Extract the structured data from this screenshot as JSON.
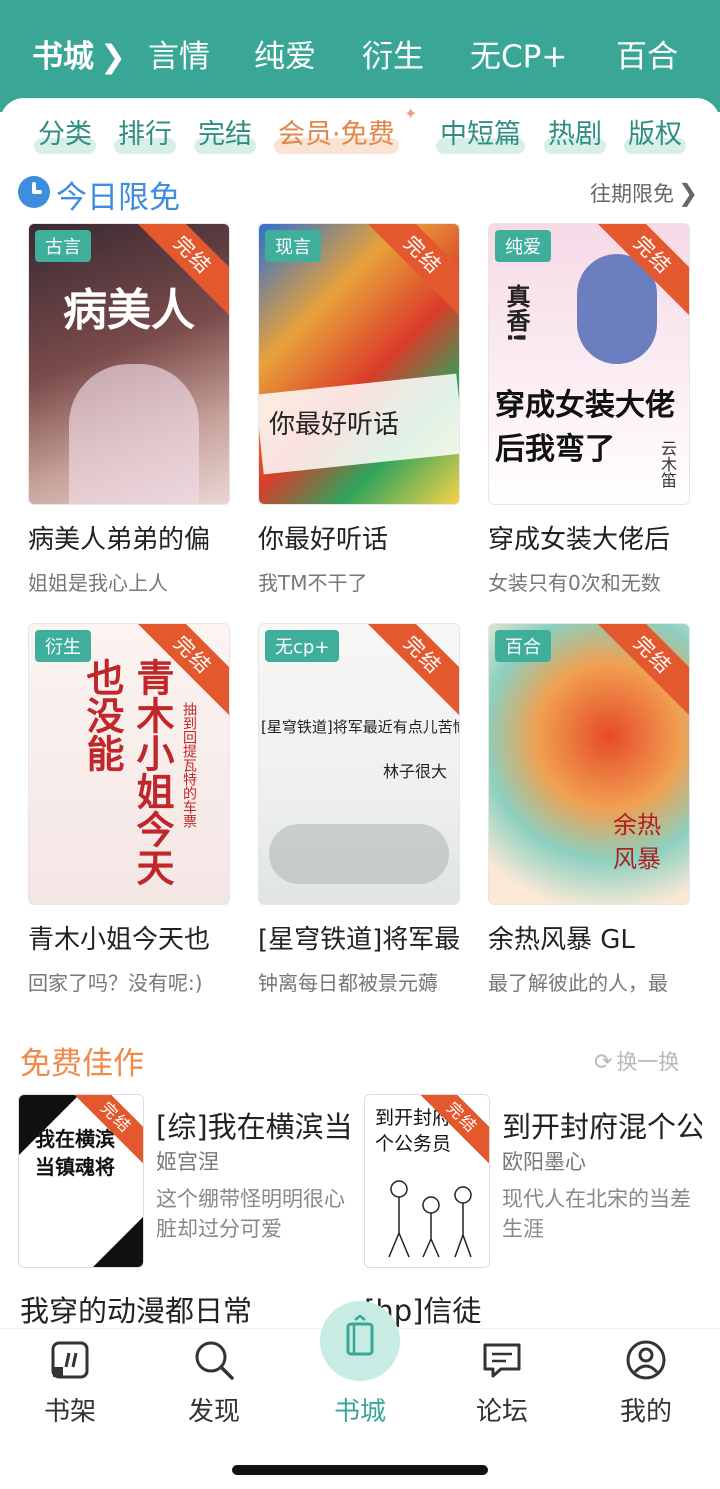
{
  "header": {
    "tabs": [
      {
        "label": "书城",
        "active": true,
        "chevron": "❯"
      },
      {
        "label": "言情"
      },
      {
        "label": "纯爱"
      },
      {
        "label": "衍生"
      },
      {
        "label": "无CP+"
      },
      {
        "label": "百合"
      }
    ],
    "accent_color": "#3aa796"
  },
  "subnav": {
    "items": [
      "分类",
      "排行",
      "完结",
      "会员·免费",
      "中短篇",
      "热剧",
      "版权"
    ]
  },
  "limited_free": {
    "title": "今日限免",
    "more": "往期限免",
    "icon": "clock-icon",
    "books": [
      {
        "genre": "古言",
        "status": "完结",
        "title": "病美人弟弟的偏",
        "desc": "姐姐是我心上人",
        "cover_text": "病美人"
      },
      {
        "genre": "现言",
        "status": "完结",
        "title": "你最好听话",
        "desc": "我TM不干了",
        "cover_text": "你最好听话"
      },
      {
        "genre": "纯爱",
        "status": "完结",
        "title": "穿成女装大佬后",
        "desc": "女装只有0次和无数",
        "cover_text": "穿成女装大佬后我弯了",
        "cover_text2": "真香!",
        "cover_author": "云木笛"
      },
      {
        "genre": "衍生",
        "status": "完结",
        "title": "青木小姐今天也",
        "desc": "回家了吗？没有呢:)",
        "cover_text": "青木小姐今天也没能",
        "cover_sub": "抽到回提瓦特的车票"
      },
      {
        "genre": "无cp+",
        "status": "完结",
        "title": "[星穹铁道]将军最",
        "desc": "钟离每日都被景元薅",
        "cover_text": "[星穹铁道]将军最近有点儿苦恼",
        "cover_author": "林子很大"
      },
      {
        "genre": "百合",
        "status": "完结",
        "title": "余热风暴 GL",
        "desc": "最了解彼此的人，最",
        "cover_text": "余热风暴"
      }
    ]
  },
  "free_works": {
    "title": "免费佳作",
    "refresh": "换一换",
    "books": [
      {
        "status": "完结",
        "title": "[综]我在横滨当",
        "author": "姬宫涅",
        "desc": "这个绷带怪明明很心脏却过分可爱",
        "cover_text": "我在横滨当镇魂将"
      },
      {
        "status": "完结",
        "title": "到开封府混个公",
        "author": "欧阳墨心",
        "desc": "现代人在北宋的当差生涯",
        "cover_text": "到开封府混个公务员"
      }
    ],
    "next_titles": [
      "我穿的动漫都日常",
      "[hp]信徒"
    ]
  },
  "bottom_nav": {
    "items": [
      {
        "label": "书架",
        "icon": "bookshelf-icon"
      },
      {
        "label": "发现",
        "icon": "search-icon"
      },
      {
        "label": "书城",
        "icon": "book-icon",
        "active": true
      },
      {
        "label": "论坛",
        "icon": "chat-icon"
      },
      {
        "label": "我的",
        "icon": "user-icon"
      }
    ]
  }
}
